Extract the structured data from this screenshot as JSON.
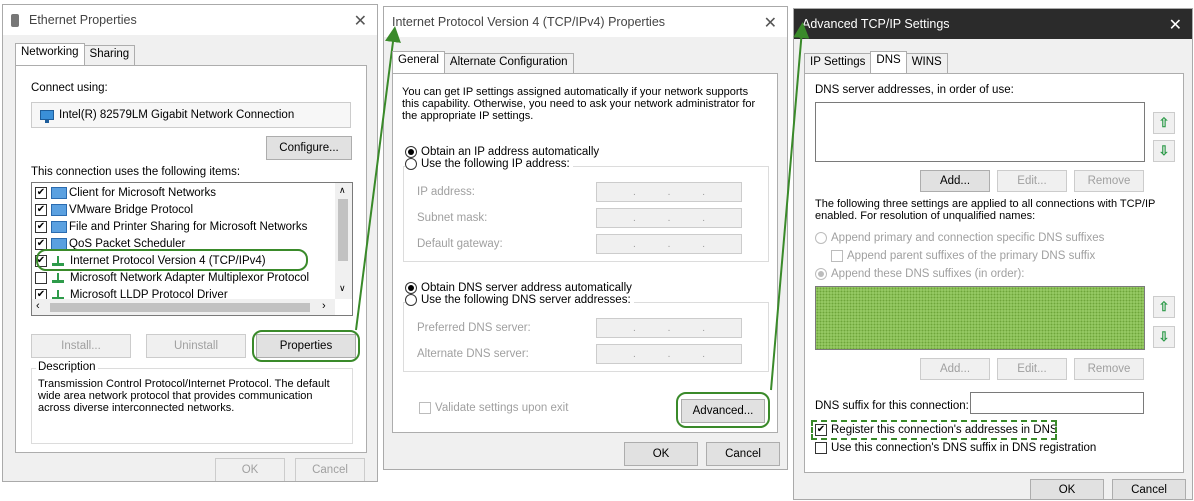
{
  "eth": {
    "title": "Ethernet Properties",
    "tabs": [
      "Networking",
      "Sharing"
    ],
    "connect_using_label": "Connect using:",
    "adapter_name": "Intel(R) 82579LM Gigabit Network Connection",
    "configure_label": "Configure...",
    "items_label": "This connection uses the following items:",
    "items": [
      {
        "label": "Client for Microsoft Networks",
        "checked": true
      },
      {
        "label": "VMware Bridge Protocol",
        "checked": true
      },
      {
        "label": "File and Printer Sharing for Microsoft Networks",
        "checked": true
      },
      {
        "label": "QoS Packet Scheduler",
        "checked": true
      },
      {
        "label": "Internet Protocol Version 4 (TCP/IPv4)",
        "checked": true
      },
      {
        "label": "Microsoft Network Adapter Multiplexor Protocol",
        "checked": false
      },
      {
        "label": "Microsoft LLDP Protocol Driver",
        "checked": true
      }
    ],
    "install_label": "Install...",
    "uninstall_label": "Uninstall",
    "properties_label": "Properties",
    "description_label": "Description",
    "description_text": "Transmission Control Protocol/Internet Protocol. The default wide area network protocol that provides communication across diverse interconnected networks.",
    "ok_label": "OK",
    "cancel_label": "Cancel"
  },
  "ipv4": {
    "title": "Internet Protocol Version 4 (TCP/IPv4) Properties",
    "tabs": [
      "General",
      "Alternate Configuration"
    ],
    "intro": "You can get IP settings assigned automatically if your network supports this capability. Otherwise, you need to ask your network administrator for the appropriate IP settings.",
    "obtain_ip_auto": "Obtain an IP address automatically",
    "use_following_ip": "Use the following IP address:",
    "ip_address_label": "IP address:",
    "subnet_mask_label": "Subnet mask:",
    "default_gateway_label": "Default gateway:",
    "obtain_dns_auto": "Obtain DNS server address automatically",
    "use_following_dns": "Use the following DNS server addresses:",
    "preferred_dns_label": "Preferred DNS server:",
    "alternate_dns_label": "Alternate DNS server:",
    "ip_dots": ".",
    "validate_label": "Validate settings upon exit",
    "advanced_label": "Advanced...",
    "ok_label": "OK",
    "cancel_label": "Cancel"
  },
  "adv": {
    "title": "Advanced TCP/IP Settings",
    "tabs": [
      "IP Settings",
      "DNS",
      "WINS"
    ],
    "dns_servers_label": "DNS server addresses, in order of use:",
    "add_label": "Add...",
    "edit_label": "Edit...",
    "remove_label": "Remove",
    "info_text": "The following three settings are applied to all connections with TCP/IP enabled. For resolution of unqualified names:",
    "append_primary": "Append primary and connection specific DNS suffixes",
    "append_parent": "Append parent suffixes of the primary DNS suffix",
    "append_these": "Append these DNS suffixes (in order):",
    "add2_label": "Add...",
    "edit2_label": "Edit...",
    "remove2_label": "Remove",
    "suffix_label": "DNS suffix for this connection:",
    "register_label": "Register this connection's addresses in DNS",
    "use_suffix_label": "Use this connection's DNS suffix in DNS registration",
    "ok_label": "OK",
    "cancel_label": "Cancel"
  },
  "colors": {
    "highlight": "#3a8a2a",
    "dark_titlebar": "#2b2b2b"
  }
}
